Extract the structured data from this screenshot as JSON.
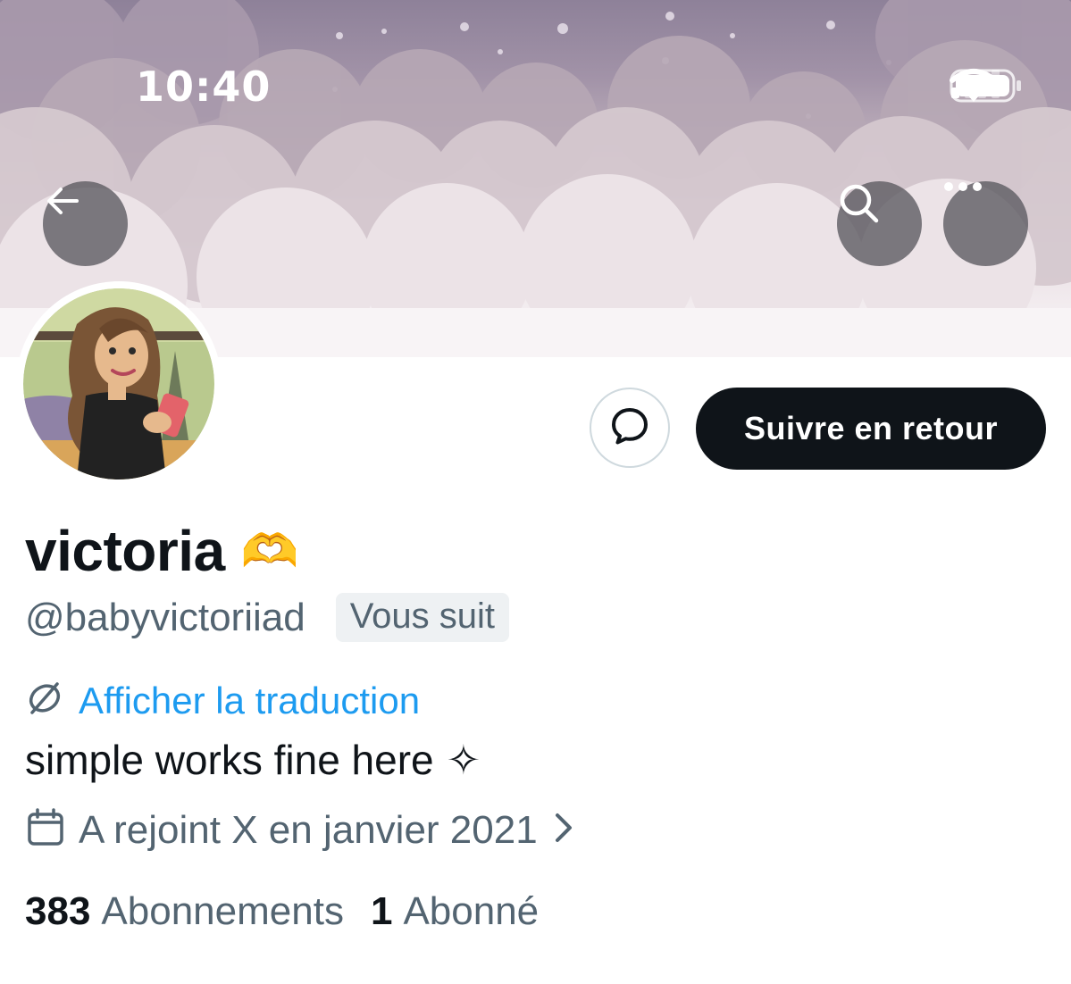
{
  "status_bar": {
    "time": "10:40",
    "icons": [
      "cellular-signal-icon",
      "wifi-icon",
      "battery-icon"
    ]
  },
  "header": {
    "back_icon": "arrow-left-icon",
    "search_icon": "search-icon",
    "more_icon": "more-horizontal-icon"
  },
  "profile": {
    "display_name": "victoria",
    "name_emoji": "🫶",
    "handle": "@babyvictoriiad",
    "follows_you_badge": "Vous suit",
    "translate_label": "Afficher la traduction",
    "translate_icon": "translate-globe-icon",
    "bio": "simple works fine here",
    "bio_symbol": "✧",
    "joined_icon": "calendar-icon",
    "joined": "A rejoint X en janvier 2021",
    "joined_chevron": "chevron-right-icon",
    "following_count": "383",
    "following_label": "Abonnements",
    "followers_count": "1",
    "followers_label": "Abonné"
  },
  "actions": {
    "message_icon": "message-bubble-icon",
    "follow_back_label": "Suivre en retour"
  },
  "colors": {
    "primary_text": "#0f1419",
    "secondary_text": "#536471",
    "link": "#1d9bf0",
    "button_dark": "#0f1419",
    "banner_top": "#8e8199"
  }
}
